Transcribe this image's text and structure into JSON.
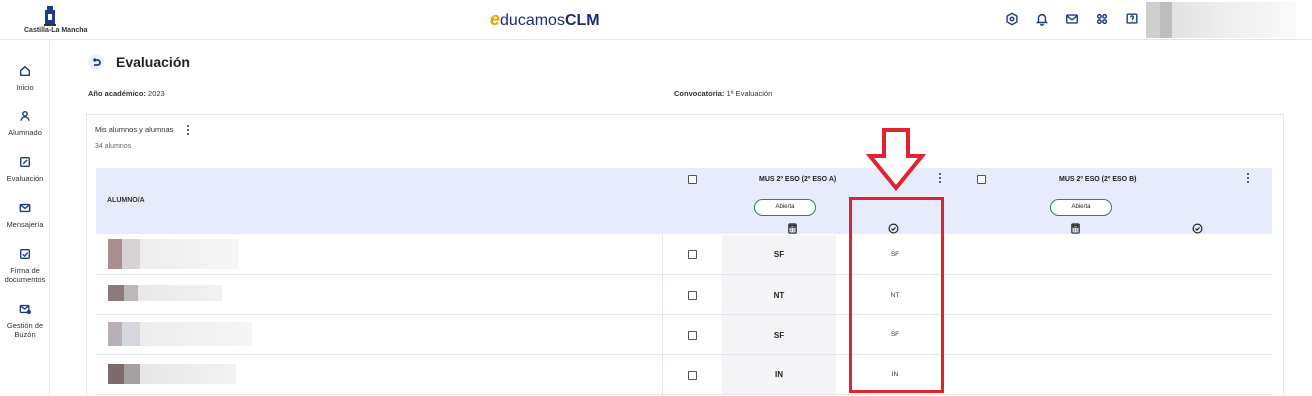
{
  "brand": {
    "crest_label": "Castilla-La Mancha",
    "app_prefix": "e",
    "app_middle": "ducamos",
    "app_suffix": "CLM"
  },
  "top_icons": [
    "settings-icon",
    "bell-icon",
    "mail-icon",
    "apps-grid-icon",
    "help-icon"
  ],
  "sidebar": {
    "items": [
      {
        "label": "Inicio",
        "icon": "home-icon"
      },
      {
        "label": "Alumnado",
        "icon": "person-icon"
      },
      {
        "label": "Evaluación",
        "icon": "edit-icon"
      },
      {
        "label": "Mensajería",
        "icon": "mail-icon"
      },
      {
        "label": "Firma de documentos",
        "icon": "signature-icon"
      },
      {
        "label": "Gestión de Buzón",
        "icon": "inbox-icon"
      }
    ]
  },
  "page": {
    "title": "Evaluación",
    "year_label": "Año académico:",
    "year_value": "2023",
    "call_label": "Convocatoria:",
    "call_value": "1ª Evaluación"
  },
  "group": {
    "title": "Mis alumnos y alumnas",
    "count": "34 alumnos"
  },
  "table": {
    "student_header": "ALUMNO/A",
    "subjects": [
      {
        "name": "MUS 2º ESO (2º ESO A)",
        "status": "Abierta"
      },
      {
        "name": "MUS 2º ESO (2º ESO B)",
        "status": "Abierta"
      }
    ],
    "rows": [
      {
        "grade": "SF",
        "grade_final": "SF"
      },
      {
        "grade": "NT",
        "grade_final": "NT"
      },
      {
        "grade": "SF",
        "grade_final": "SF"
      },
      {
        "grade": "IN",
        "grade_final": "IN"
      }
    ]
  },
  "colors": {
    "accent": "#1e3a8a",
    "header_bg": "#e8ebfb",
    "annotation": "#e0232e",
    "status_border": "#1f8a5c"
  }
}
